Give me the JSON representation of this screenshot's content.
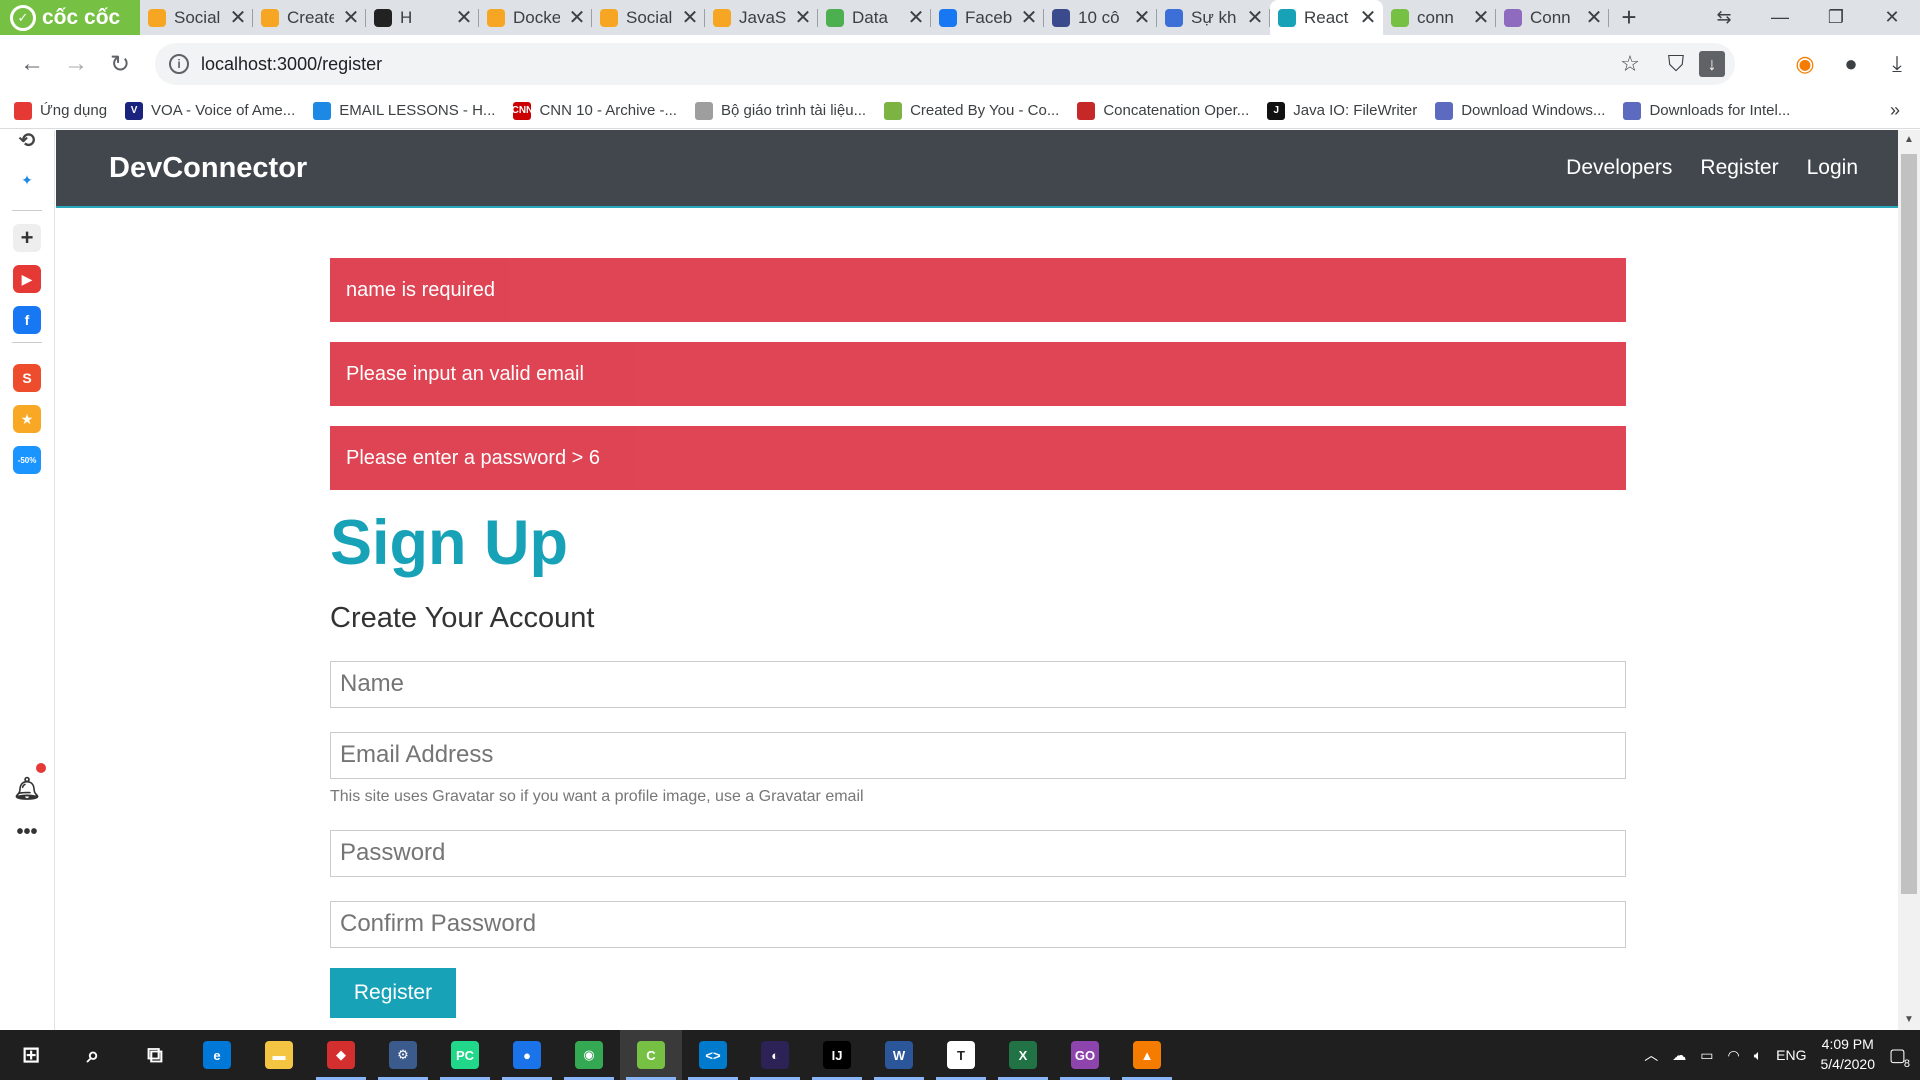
{
  "browser": {
    "brand": "cốc cốc",
    "tabs": [
      {
        "title": "Social",
        "color": "#f6a623"
      },
      {
        "title": "Create",
        "color": "#f6a623"
      },
      {
        "title": "H",
        "color": "#222222"
      },
      {
        "title": "Docke",
        "color": "#f6a623"
      },
      {
        "title": "Social",
        "color": "#f6a623"
      },
      {
        "title": "JavaS",
        "color": "#f6a623"
      },
      {
        "title": "Data",
        "color": "#4caf50"
      },
      {
        "title": "Faceb",
        "color": "#1877f2"
      },
      {
        "title": "10 cô",
        "color": "#3b4a8c"
      },
      {
        "title": "Sự kh",
        "color": "#3d6fd8"
      },
      {
        "title": "React",
        "color": "#17a2b8"
      },
      {
        "title": "conn",
        "color": "#76c043"
      },
      {
        "title": "Conn",
        "color": "#8e6bbf"
      }
    ],
    "active_tab_index": 10,
    "url": "localhost:3000/register",
    "bookmarks": [
      {
        "label": "Ứng dụng",
        "color": "#e53935",
        "glyph": ""
      },
      {
        "label": "VOA - Voice of Ame...",
        "color": "#1a237e",
        "glyph": "V"
      },
      {
        "label": "EMAIL LESSONS - H...",
        "color": "#1e88e5",
        "glyph": ""
      },
      {
        "label": "CNN 10 - Archive -...",
        "color": "#cc0000",
        "glyph": "CNN"
      },
      {
        "label": "Bộ giáo trình tài liệu...",
        "color": "#9e9e9e",
        "glyph": ""
      },
      {
        "label": "Created By You - Co...",
        "color": "#7cb342",
        "glyph": ""
      },
      {
        "label": "Concatenation Oper...",
        "color": "#c62828",
        "glyph": ""
      },
      {
        "label": "Java IO: FileWriter",
        "color": "#111111",
        "glyph": "J"
      },
      {
        "label": "Download Windows...",
        "color": "#5c6bc0",
        "glyph": ""
      },
      {
        "label": "Downloads for Intel...",
        "color": "#5c6bc0",
        "glyph": ""
      }
    ]
  },
  "sidebar": [
    {
      "name": "history-icon",
      "color": "#444444",
      "glyph": "⟲"
    },
    {
      "name": "messenger-icon",
      "color": "#1e88e5",
      "glyph": "✦"
    },
    {
      "name": "add-icon",
      "color": "#cccccc",
      "glyph": "+"
    },
    {
      "name": "youtube-icon",
      "color": "#e53935",
      "glyph": "▶"
    },
    {
      "name": "facebook-icon",
      "color": "#1877f2",
      "glyph": "f"
    },
    {
      "name": "shopee-icon",
      "color": "#ee4d2d",
      "glyph": "S"
    },
    {
      "name": "game-icon",
      "color": "#f9a825",
      "glyph": "★"
    },
    {
      "name": "tiki-icon",
      "color": "#1a94ff",
      "glyph": "-50%"
    }
  ],
  "app": {
    "logo": "DevConnector",
    "nav_links": [
      "Developers",
      "Register",
      "Login"
    ],
    "alerts": [
      "name is required",
      "Please input an valid email",
      "Please enter a password > 6"
    ],
    "heading": "Sign Up",
    "lead": "Create Your Account",
    "form": {
      "name_placeholder": "Name",
      "email_placeholder": "Email Address",
      "email_help": "This site uses Gravatar so if you want a profile image, use a Gravatar email",
      "password_placeholder": "Password",
      "confirm_placeholder": "Confirm Password",
      "submit_label": "Register"
    }
  },
  "taskbar": {
    "apps": [
      {
        "name": "start-icon",
        "glyph": "⊞",
        "color": "transparent"
      },
      {
        "name": "search-icon",
        "glyph": "⌕",
        "color": "transparent"
      },
      {
        "name": "task-view-icon",
        "glyph": "⧉",
        "color": "transparent"
      },
      {
        "name": "edge-icon",
        "glyph": "e",
        "color": "#0078d7"
      },
      {
        "name": "file-explorer-icon",
        "glyph": "▬",
        "color": "#f4c542"
      },
      {
        "name": "car-app-icon",
        "glyph": "◆",
        "color": "#d32f2f"
      },
      {
        "name": "mysql-icon",
        "glyph": "⚙",
        "color": "#3b5b8c"
      },
      {
        "name": "pycharm-icon",
        "glyph": "PC",
        "color": "#21d789"
      },
      {
        "name": "maps-icon",
        "glyph": "●",
        "color": "#1a73e8"
      },
      {
        "name": "chrome-icon",
        "glyph": "◉",
        "color": "#34a853"
      },
      {
        "name": "coccoc-icon",
        "glyph": "C",
        "color": "#76c043"
      },
      {
        "name": "vscode-icon",
        "glyph": "<>",
        "color": "#007acc"
      },
      {
        "name": "eclipse-icon",
        "glyph": "◐",
        "color": "#2c2255"
      },
      {
        "name": "intellij-icon",
        "glyph": "IJ",
        "color": "#000000"
      },
      {
        "name": "word-icon",
        "glyph": "W",
        "color": "#2b579a"
      },
      {
        "name": "typora-icon",
        "glyph": "T",
        "color": "#ffffff"
      },
      {
        "name": "excel-icon",
        "glyph": "X",
        "color": "#217346"
      },
      {
        "name": "goland-icon",
        "glyph": "GO",
        "color": "#8e44ad"
      },
      {
        "name": "vlc-icon",
        "glyph": "▲",
        "color": "#f57c00"
      }
    ],
    "language": "ENG",
    "time": "4:09 PM",
    "date": "5/4/2020",
    "notification_count": "8"
  }
}
